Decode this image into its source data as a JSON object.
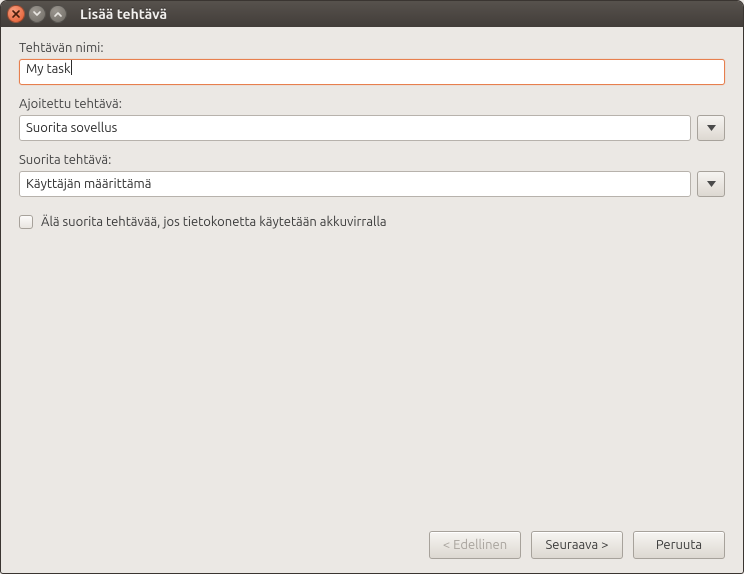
{
  "window": {
    "title": "Lisää tehtävä"
  },
  "fields": {
    "name": {
      "label": "Tehtävän nimi:",
      "value": "My task"
    },
    "scheduled": {
      "label": "Ajoitettu tehtävä:",
      "value": "Suorita sovellus"
    },
    "runwhen": {
      "label": "Suorita tehtävä:",
      "value": "Käyttäjän määrittämä"
    },
    "battery": {
      "label": "Älä suorita tehtävää, jos tietokonetta käytetään akkuvirralla"
    }
  },
  "buttons": {
    "prev": "< Edellinen",
    "next": "Seuraava >",
    "cancel": "Peruuta"
  }
}
